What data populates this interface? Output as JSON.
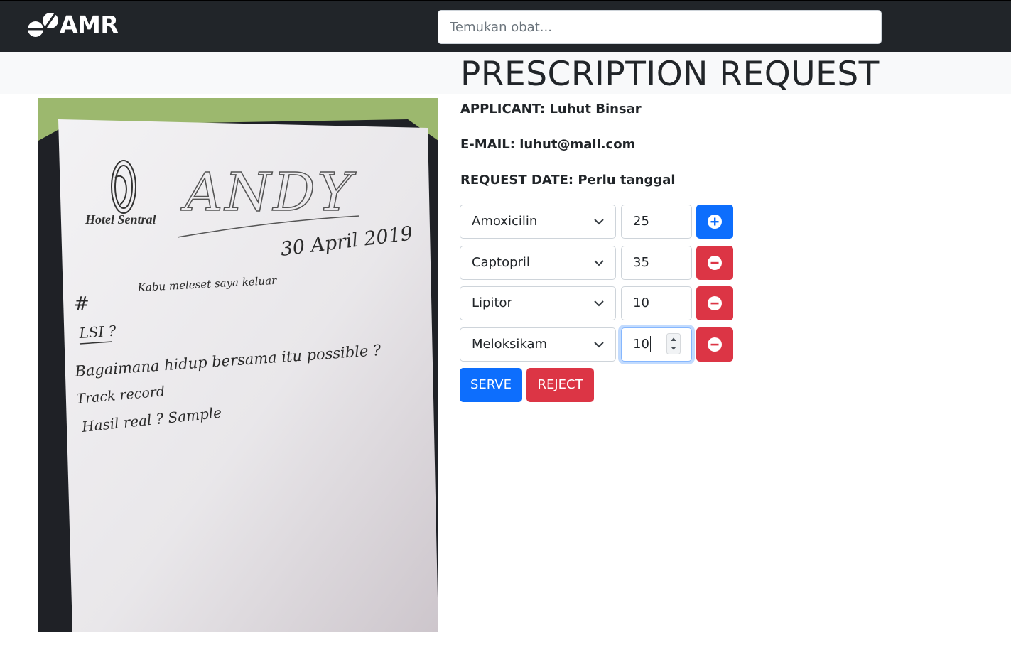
{
  "app": {
    "brand": "AMR"
  },
  "search": {
    "placeholder": "Temukan obat..."
  },
  "page": {
    "title": "PRESCRIPTION REQUEST"
  },
  "request": {
    "applicant": "APPLICANT: Luhut Binsar",
    "email": "E-MAIL: luhut@mail.com",
    "date": "REQUEST DATE: Perlu tanggal"
  },
  "prescription_photo": {
    "hotel_logo_text": "Hotel Sentral",
    "handwriting": [
      "ANDY",
      "30 April 2019",
      "Kabu meleset saya keluar",
      "#",
      "LSI ?",
      "Bagaimana hidup bersama itu possible ?",
      "Track record",
      "Hasil real ? Sample"
    ]
  },
  "items": [
    {
      "medicine": "Amoxicilin",
      "quantity": "25",
      "action": "add"
    },
    {
      "medicine": "Captopril",
      "quantity": "35",
      "action": "remove"
    },
    {
      "medicine": "Lipitor",
      "quantity": "10",
      "action": "remove"
    },
    {
      "medicine": "Meloksikam",
      "quantity": "10",
      "action": "remove"
    }
  ],
  "actions": {
    "serve": "SERVE",
    "reject": "REJECT"
  },
  "icons": {
    "brand": "pills-icon",
    "add": "plus-circle-icon",
    "remove": "minus-circle-icon",
    "dropdown": "chevron-down-icon",
    "spinner": "number-spinner-icon"
  },
  "colors": {
    "navbar": "#212529",
    "primary": "#0d6efd",
    "danger": "#dc3545",
    "band": "#f8f9fa"
  }
}
